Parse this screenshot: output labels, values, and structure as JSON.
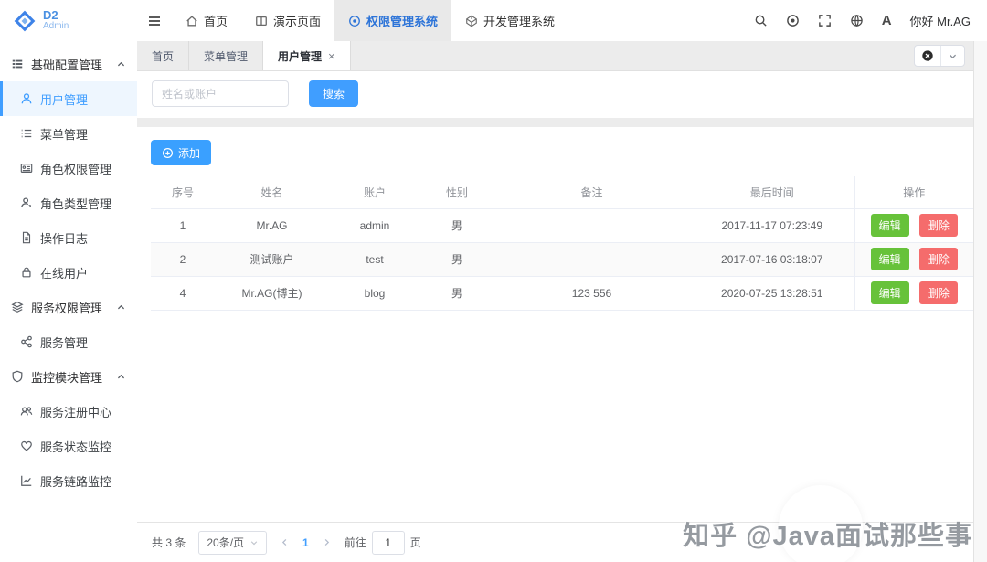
{
  "brand": {
    "line1": "D2",
    "line2": "Admin"
  },
  "header": {
    "nav": [
      {
        "label": "首页"
      },
      {
        "label": "演示页面"
      },
      {
        "label": "权限管理系统"
      },
      {
        "label": "开发管理系统"
      }
    ],
    "font_icon_glyph": "A",
    "greeting": "你好 Mr.AG"
  },
  "sidebar": {
    "groups": [
      {
        "label": "基础配置管理",
        "items": [
          {
            "label": "用户管理"
          },
          {
            "label": "菜单管理"
          },
          {
            "label": "角色权限管理"
          },
          {
            "label": "角色类型管理"
          },
          {
            "label": "操作日志"
          },
          {
            "label": "在线用户"
          }
        ]
      },
      {
        "label": "服务权限管理",
        "items": [
          {
            "label": "服务管理"
          }
        ]
      },
      {
        "label": "监控模块管理",
        "items": [
          {
            "label": "服务注册中心"
          },
          {
            "label": "服务状态监控"
          },
          {
            "label": "服务链路监控"
          }
        ]
      }
    ]
  },
  "tabs": {
    "items": [
      {
        "label": "首页"
      },
      {
        "label": "菜单管理"
      },
      {
        "label": "用户管理"
      }
    ],
    "close_glyph": "×"
  },
  "search": {
    "placeholder": "姓名或账户",
    "button_label": "搜索"
  },
  "toolbar": {
    "add_label": "添加"
  },
  "table": {
    "headers": [
      "序号",
      "姓名",
      "账户",
      "性别",
      "备注",
      "最后时间",
      "操作"
    ],
    "edit_label": "编辑",
    "delete_label": "删除",
    "rows": [
      {
        "id": "1",
        "name": "Mr.AG",
        "account": "admin",
        "gender": "男",
        "remark": "",
        "time": "2017-11-17 07:23:49"
      },
      {
        "id": "2",
        "name": "测试账户",
        "account": "test",
        "gender": "男",
        "remark": "",
        "time": "2017-07-16 03:18:07"
      },
      {
        "id": "4",
        "name": "Mr.AG(博主)",
        "account": "blog",
        "gender": "男",
        "remark": "123 556",
        "time": "2020-07-25 13:28:51"
      }
    ]
  },
  "pagination": {
    "total_label": "共 3 条",
    "page_size_label": "20条/页",
    "current_page": "1",
    "goto_label": "前往",
    "goto_value": "1",
    "goto_unit": "页"
  },
  "watermark": {
    "text": "知乎 @Java面试那些事"
  },
  "colors": {
    "primary": "#409eff",
    "success": "#67c23a",
    "danger": "#f56c6c",
    "nav_active": "#2d74d8"
  }
}
